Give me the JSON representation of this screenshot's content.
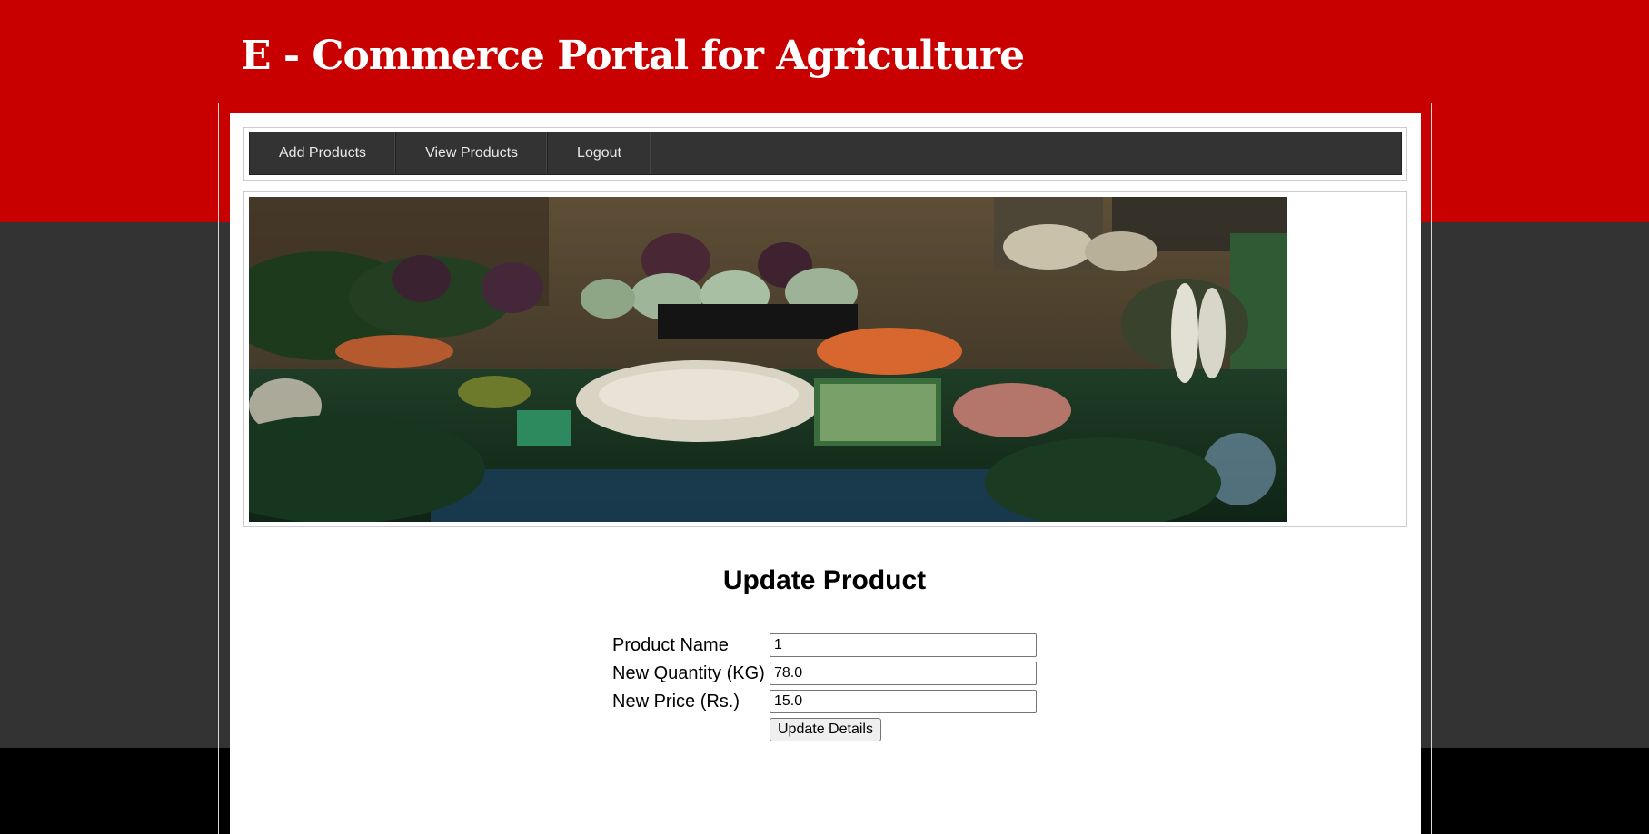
{
  "header": {
    "title": "E - Commerce Portal for Agriculture"
  },
  "nav": {
    "items": [
      {
        "label": "Add Products"
      },
      {
        "label": "View Products"
      },
      {
        "label": "Logout"
      }
    ]
  },
  "banner": {
    "description": "vegetable market stall photo"
  },
  "form": {
    "title": "Update Product",
    "fields": [
      {
        "label": "Product Name",
        "value": "1"
      },
      {
        "label": "New Quantity (KG)",
        "value": "78.0"
      },
      {
        "label": "New Price (Rs.)",
        "value": "15.0"
      }
    ],
    "submit_label": "Update Details"
  },
  "colors": {
    "header_red": "#c80000",
    "band_grey": "#333333",
    "nav_bg": "#333333"
  }
}
